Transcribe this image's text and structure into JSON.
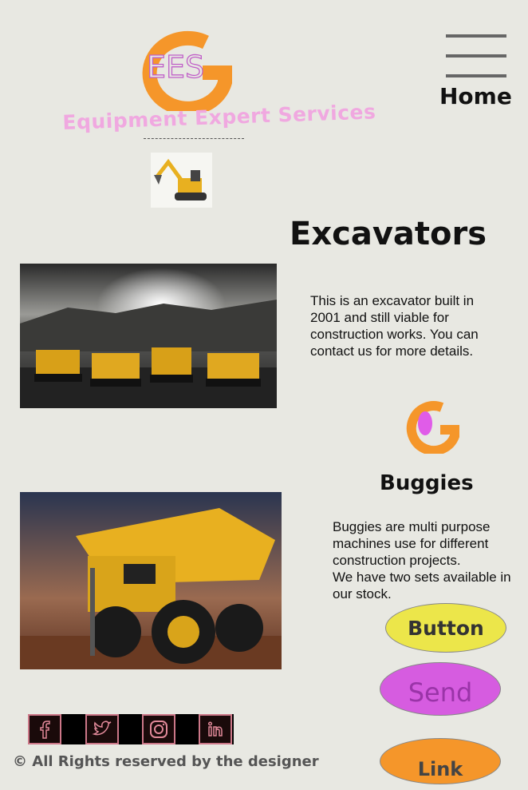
{
  "brand": {
    "logo_text": "EES",
    "name": "Equipment Expert Services"
  },
  "nav": {
    "home_label": "Home",
    "menu_icon": "hamburger-menu-icon"
  },
  "excavators": {
    "title": "Excavators",
    "description": "This is an excavator built in 2001 and still viable for construction works. You can contact us for more details."
  },
  "buggies": {
    "title": "Buggies",
    "description_1": "Buggies are multi purpose machines use for different construction projects.",
    "description_2": "We have two sets available in our stock."
  },
  "buttons": {
    "button_label": "Button",
    "send_label": "Send",
    "link_label": "Link"
  },
  "social": [
    {
      "icon": "facebook-icon"
    },
    {
      "icon": "twitter-icon"
    },
    {
      "icon": "instagram-icon"
    },
    {
      "icon": "linkedin-icon"
    }
  ],
  "footer": {
    "copyright": "© All Rights reserved by the designer"
  },
  "colors": {
    "background": "#e8e8e2",
    "brand_orange": "#f5962a",
    "brand_pink": "#f0a8e0",
    "button_yellow": "#ece64a",
    "button_magenta": "#d65ce0"
  }
}
